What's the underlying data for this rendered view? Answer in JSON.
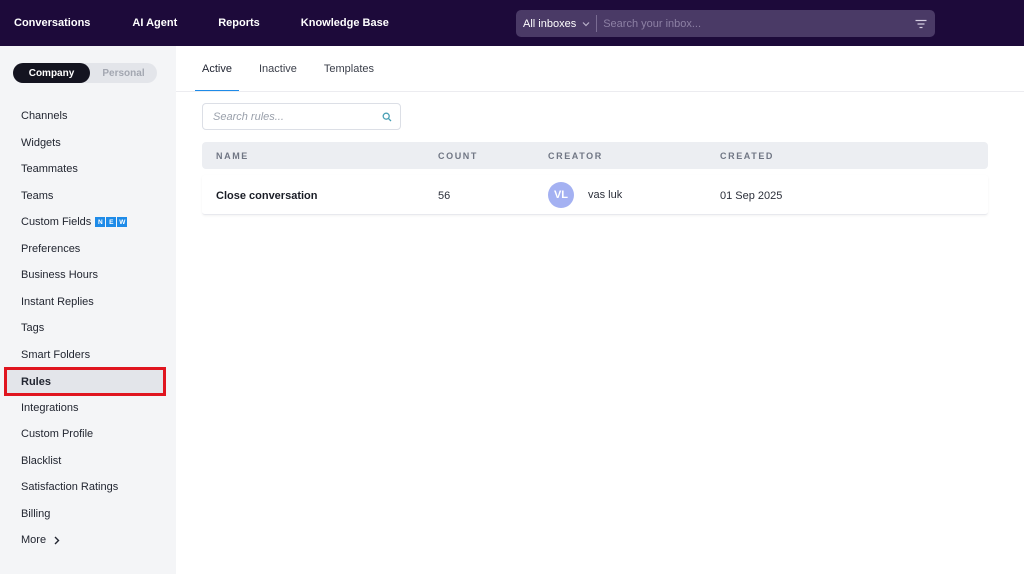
{
  "topnav": {
    "items": [
      {
        "label": "Conversations"
      },
      {
        "label": "AI Agent"
      },
      {
        "label": "Reports"
      },
      {
        "label": "Knowledge Base"
      }
    ]
  },
  "search": {
    "inbox_label": "All inboxes",
    "placeholder": "Search your inbox..."
  },
  "sidebar": {
    "scope": {
      "company": "Company",
      "personal": "Personal",
      "selected": "Company"
    },
    "items": [
      {
        "label": "Channels"
      },
      {
        "label": "Widgets"
      },
      {
        "label": "Teammates"
      },
      {
        "label": "Teams"
      },
      {
        "label": "Custom Fields",
        "badge": [
          "N",
          "E",
          "W"
        ]
      },
      {
        "label": "Preferences"
      },
      {
        "label": "Business Hours"
      },
      {
        "label": "Instant Replies"
      },
      {
        "label": "Tags"
      },
      {
        "label": "Smart Folders"
      },
      {
        "label": "Rules",
        "active": true
      },
      {
        "label": "Integrations"
      },
      {
        "label": "Custom Profile"
      },
      {
        "label": "Blacklist"
      },
      {
        "label": "Satisfaction Ratings"
      },
      {
        "label": "Billing"
      },
      {
        "label": "More"
      }
    ]
  },
  "tabs": [
    {
      "label": "Active",
      "active": true
    },
    {
      "label": "Inactive"
    },
    {
      "label": "Templates"
    }
  ],
  "rules_search": {
    "placeholder": "Search rules..."
  },
  "table": {
    "columns": [
      "NAME",
      "COUNT",
      "CREATOR",
      "CREATED"
    ],
    "rows": [
      {
        "name": "Close conversation",
        "count": "56",
        "creator_initials": "VL",
        "creator": "vas luk",
        "created": "01 Sep 2025"
      }
    ]
  },
  "colors": {
    "topbar_bg": "#1d0a3a",
    "accent": "#1e8be8",
    "highlight_border": "#e0151f",
    "avatar_bg": "#a4b1f2"
  }
}
